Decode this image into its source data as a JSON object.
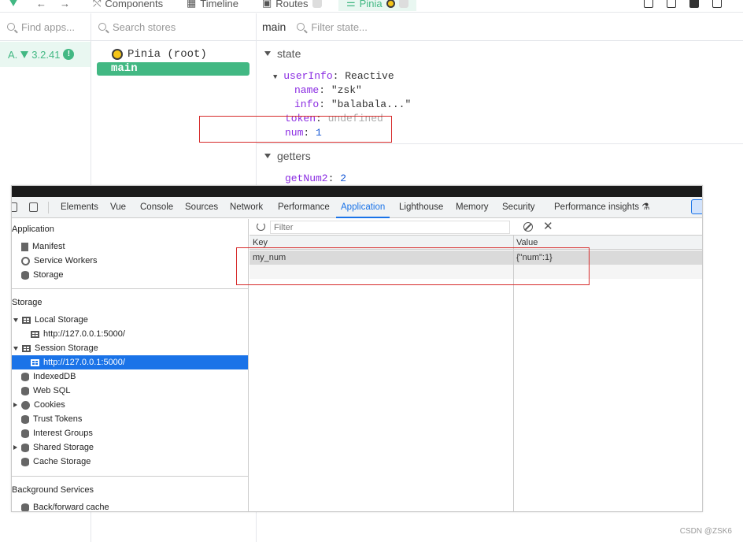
{
  "vue": {
    "tabs": [
      {
        "label": "Components"
      },
      {
        "label": "Timeline"
      },
      {
        "label": "Routes"
      },
      {
        "label": "Pinia"
      }
    ],
    "apps_search_placeholder": "Find apps...",
    "app_letter": "A.",
    "app_version": "3.2.41",
    "stores_search_placeholder": "Search stores",
    "stores": [
      {
        "label": "Pinia (root)"
      },
      {
        "label": "main"
      }
    ],
    "inspector_title": "main",
    "state_filter_placeholder": "Filter state...",
    "state_section": "state",
    "state_lines": {
      "userinfo_key": "userInfo",
      "userinfo_val": "Reactive",
      "name_key": "name",
      "name_val": "\"zsk\"",
      "info_key": "info",
      "info_val": "\"balabala...\"",
      "token_key": "token",
      "token_val": "undefined",
      "num_key": "num",
      "num_val": "1"
    },
    "getters_section": "getters",
    "getter_key": "getNum2",
    "getter_val": "2"
  },
  "devtools": {
    "tabs": [
      {
        "label": "Elements"
      },
      {
        "label": "Vue"
      },
      {
        "label": "Console"
      },
      {
        "label": "Sources"
      },
      {
        "label": "Network"
      },
      {
        "label": "Performance"
      },
      {
        "label": "Application"
      },
      {
        "label": "Lighthouse"
      },
      {
        "label": "Memory"
      },
      {
        "label": "Security"
      },
      {
        "label": "Performance insights"
      }
    ],
    "active_tab": "Application",
    "sidebar": {
      "application_header": "Application",
      "manifest": "Manifest",
      "service_workers": "Service Workers",
      "storage": "Storage",
      "storage_header": "Storage",
      "local_storage": "Local Storage",
      "local_origin": "http://127.0.0.1:5000/",
      "session_storage": "Session Storage",
      "session_origin": "http://127.0.0.1:5000/",
      "indexeddb": "IndexedDB",
      "websql": "Web SQL",
      "cookies": "Cookies",
      "trust_tokens": "Trust Tokens",
      "interest_groups": "Interest Groups",
      "shared_storage": "Shared Storage",
      "cache_storage": "Cache Storage",
      "background_header": "Background Services",
      "bfcache": "Back/forward cache"
    },
    "filter_placeholder": "Filter",
    "table": {
      "key_header": "Key",
      "value_header": "Value",
      "rows": [
        {
          "key": "my_num",
          "value": "{\"num\":1}"
        }
      ]
    }
  },
  "watermark": "CSDN @ZSK6",
  "colors": {
    "vue_green": "#42b883",
    "chrome_blue": "#1a73e8",
    "annotation_red": "#d62b2b"
  }
}
